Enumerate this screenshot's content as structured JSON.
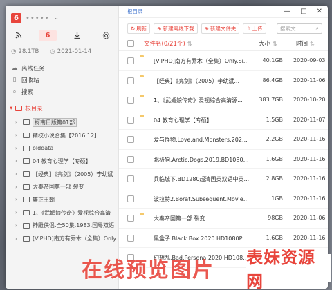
{
  "account": {
    "logo": "6",
    "username": "•••••",
    "menu_icon": "chevron-down-icon"
  },
  "toolbar": {
    "feed_icon": "rss-icon",
    "badge": "6",
    "download_icon": "download-icon",
    "settings_icon": "gear-icon"
  },
  "stats": {
    "storage": "28.1TB",
    "date": "2021-01-14"
  },
  "nav": [
    {
      "label": "离线任务",
      "icon": "cloud-icon"
    },
    {
      "label": "回收站",
      "icon": "trash-icon"
    },
    {
      "label": "搜索",
      "icon": "search-icon"
    }
  ],
  "tree_root": "根目录",
  "tree": [
    "柯南日版第01部",
    "精校小说合集【2016.12】",
    "olddata",
    "04 教育心理学【专硕】",
    "【经典】《亮剑》（2005）李幼斌",
    "大秦帝国第一部 裂变",
    "雍正王朝",
    "1、《武媚娘传奇》爱视综合高清",
    "神雕侠侣.全50集.1983.国粤双语",
    "[ViPHD]南方有乔木（全集）Only"
  ],
  "breadcrumb": "根目录",
  "window_controls": [
    "minimize-icon",
    "maximize-icon",
    "close-icon"
  ],
  "actions": {
    "refresh": "刷新",
    "offline_download": "新建离线下载",
    "new_folder": "新建文件夹",
    "upload": "上传",
    "search_placeholder": "搜索文..."
  },
  "table": {
    "name_header": "文件名(0/21个)",
    "size_header": "大小",
    "time_header": "时间",
    "rows": [
      {
        "type": "folder",
        "name": "[ViPHD]南方有乔木（全集）Only.Sid...",
        "size": "40.1GB",
        "time": "2020-09-03"
      },
      {
        "type": "folder",
        "name": "【经典】《亮剑》（2005）李幼斌...",
        "size": "86.4GB",
        "time": "2020-11-06"
      },
      {
        "type": "folder",
        "name": "1、《武媚娘传奇》爱视综合高清源...",
        "size": "383.7GB",
        "time": "2020-10-20"
      },
      {
        "type": "folder",
        "name": "04 教育心理学【专硕】",
        "size": "1.5GB",
        "time": "2020-11-07"
      },
      {
        "type": "video",
        "name": "爱与怪物.Love.and.Monsters.2020....",
        "size": "2.2GB",
        "time": "2020-11-16"
      },
      {
        "type": "video",
        "name": "北极狗.Arctic.Dogs.2019.BD1080p....",
        "size": "1.6GB",
        "time": "2020-11-16"
      },
      {
        "type": "video",
        "name": "兵临城下.BD1280超清国英双语中英...",
        "size": "2.8GB",
        "time": "2020-11-16"
      },
      {
        "type": "video",
        "name": "波拉特2.Borat.Subsequent.Moviefil...",
        "size": "1GB",
        "time": "2020-11-16"
      },
      {
        "type": "folder",
        "name": "大秦帝国第一部 裂变",
        "size": "98GB",
        "time": "2020-11-06"
      },
      {
        "type": "video",
        "name": "黑盒子.Black.Box.2020.HD1080P.中...",
        "size": "1.6GB",
        "time": "2020-11-16"
      },
      {
        "type": "video",
        "name": "幻想乱.Bad.Persona.2020.HD1080...",
        "size": "",
        "time": "2020-11-16"
      }
    ]
  },
  "watermark": {
    "left": "在线预览图片",
    "right": "表妹资源网"
  },
  "colors": {
    "accent": "#e8453c",
    "link": "#4a7bd0",
    "folder": "#f5c96b"
  }
}
